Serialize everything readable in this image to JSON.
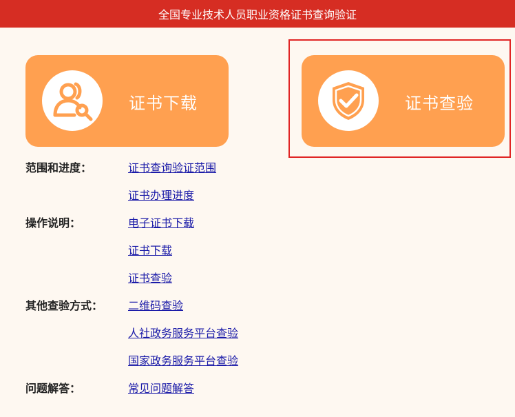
{
  "header": {
    "title": "全国专业技术人员职业资格证书查询验证"
  },
  "cards": {
    "download": {
      "label": "证书下载",
      "icon": "user-search-icon"
    },
    "verify": {
      "label": "证书查验",
      "icon": "shield-check-icon"
    }
  },
  "colors": {
    "header_bg": "#d62d23",
    "card_bg": "#ffa050",
    "link": "#1a1aa8",
    "highlight": "#e02424",
    "page_bg": "#fef8f1"
  },
  "sections": [
    {
      "label": "范围和进度：",
      "links": [
        "证书查询验证范围",
        "证书办理进度"
      ]
    },
    {
      "label": "操作说明：",
      "links": [
        "电子证书下载",
        "证书下载",
        "证书查验"
      ]
    },
    {
      "label": "其他查验方式：",
      "links": [
        "二维码查验",
        "人社政务服务平台查验",
        "国家政务服务平台查验"
      ]
    },
    {
      "label": "问题解答：",
      "links": [
        "常见问题解答"
      ]
    }
  ]
}
